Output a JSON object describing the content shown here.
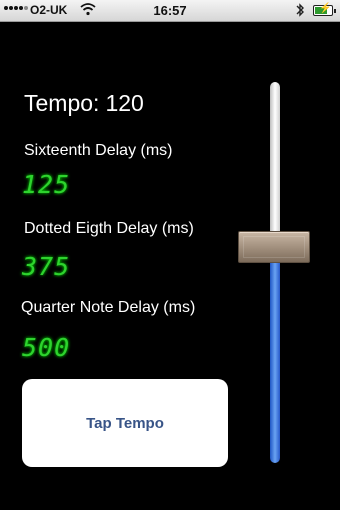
{
  "status_bar": {
    "carrier": "O2-UK",
    "time": "16:57",
    "battery_state": "charging"
  },
  "tempo": {
    "label": "Tempo:",
    "value": "120"
  },
  "delays": {
    "sixteenth_label": "Sixteenth Delay (ms)",
    "sixteenth_value": "125",
    "dotted_eighth_label": "Dotted Eigth Delay (ms)",
    "dotted_eighth_value": "375",
    "quarter_label": "Quarter Note Delay (ms)",
    "quarter_value": "500"
  },
  "tap_button": {
    "label": "Tap Tempo"
  },
  "slider": {
    "level_fraction": 0.47
  },
  "colors": {
    "lcd_green": "#2ed32e",
    "button_text": "#385487",
    "slider_fill": "#2658c9"
  }
}
